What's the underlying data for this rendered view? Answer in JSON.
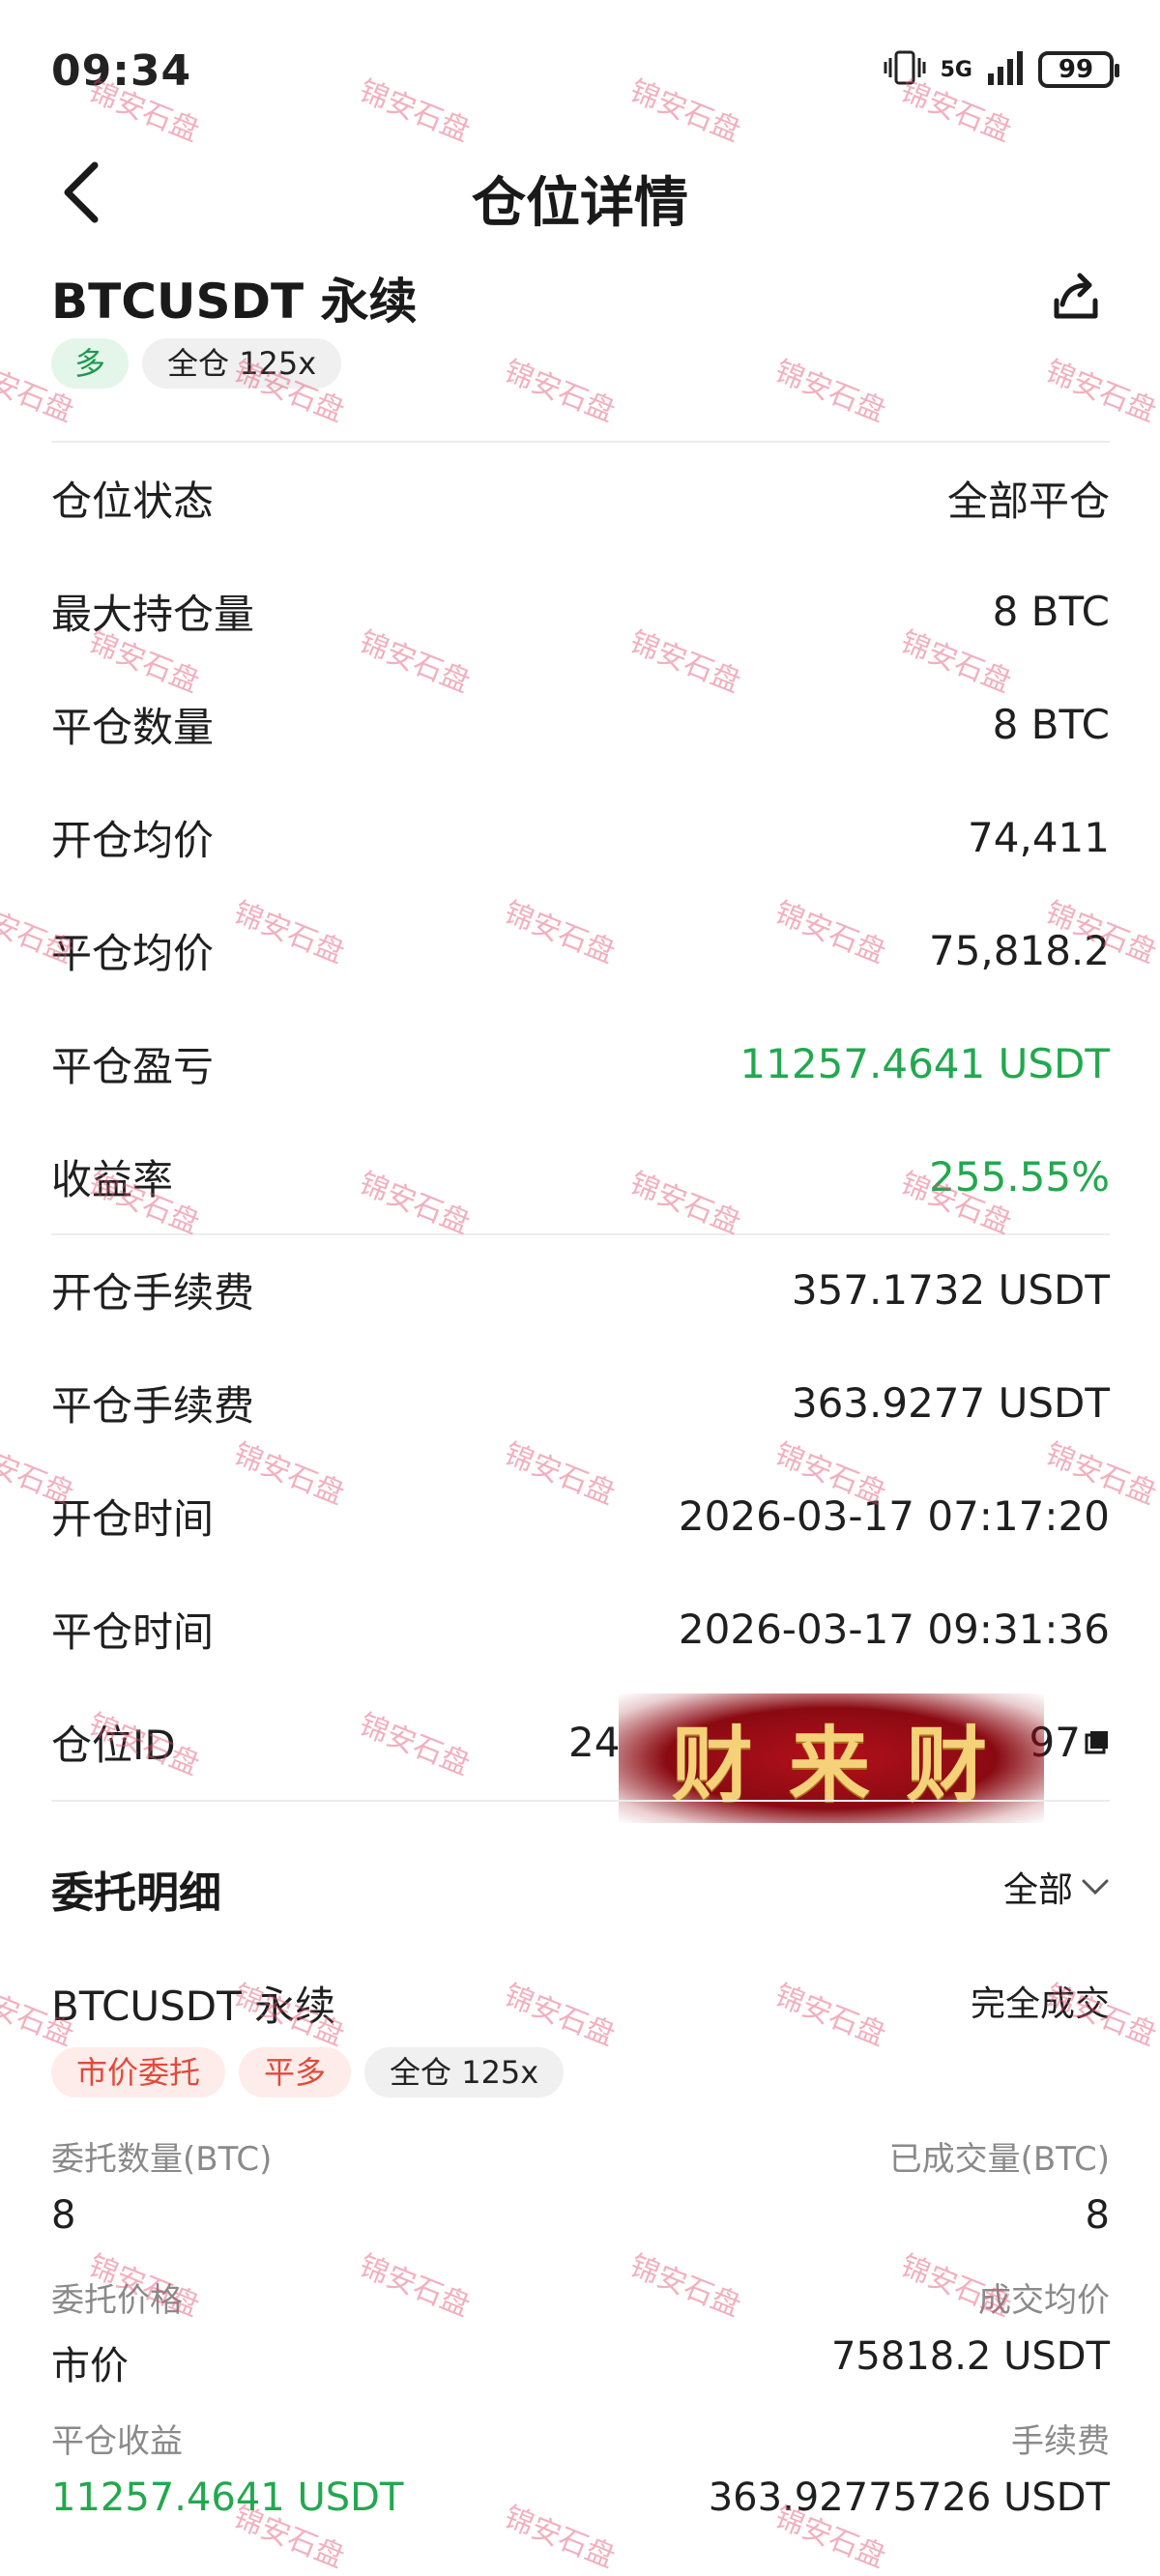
{
  "status_bar": {
    "time": "09:34",
    "network": "5G",
    "battery": "99"
  },
  "header": {
    "title": "仓位详情"
  },
  "position": {
    "symbol": "BTCUSDT 永续",
    "tags": [
      "多",
      "全仓 125x"
    ],
    "fields": [
      {
        "label": "仓位状态",
        "value": "全部平仓"
      },
      {
        "label": "最大持仓量",
        "value": "8 BTC"
      },
      {
        "label": "平仓数量",
        "value": "8 BTC"
      },
      {
        "label": "开仓均价",
        "value": "74,411"
      },
      {
        "label": "平仓均价",
        "value": "75,818.2"
      },
      {
        "label": "平仓盈亏",
        "value": "11257.4641 USDT"
      },
      {
        "label": "收益率",
        "value": "255.55%"
      },
      {
        "label": "开仓手续费",
        "value": "357.1732 USDT"
      },
      {
        "label": "平仓手续费",
        "value": "363.9277 USDT"
      },
      {
        "label": "开仓时间",
        "value": "2026-03-17 07:17:20"
      },
      {
        "label": "平仓时间",
        "value": "2026-03-17 09:31:36"
      },
      {
        "label": "仓位ID",
        "value_prefix": "24",
        "value_suffix": "97"
      }
    ]
  },
  "orders": {
    "section_title": "委托明细",
    "filter_label": "全部",
    "order": {
      "symbol": "BTCUSDT 永续",
      "status": "完全成交",
      "tags": [
        "市价委托",
        "平多",
        "全仓 125x"
      ],
      "qty_label": "委托数量(BTC)",
      "qty_value": "8",
      "filled_label": "已成交量(BTC)",
      "filled_value": "8",
      "price_label": "委托价格",
      "price_value": "市价",
      "avg_label": "成交均价",
      "avg_value": "75818.2 USDT",
      "pnl_label": "平仓收益",
      "pnl_value": "11257.4641 USDT",
      "fee_label": "手续费",
      "fee_value": "363.92775726 USDT"
    }
  },
  "overlay": {
    "watermark_text": "锦安石盘",
    "banner_text": "财 来 财"
  },
  "colors": {
    "profit_green": "#22a84f",
    "long_tag_bg": "#e4f6ea",
    "red_tag_text": "#e04b3a",
    "watermark": "#e2506e"
  }
}
